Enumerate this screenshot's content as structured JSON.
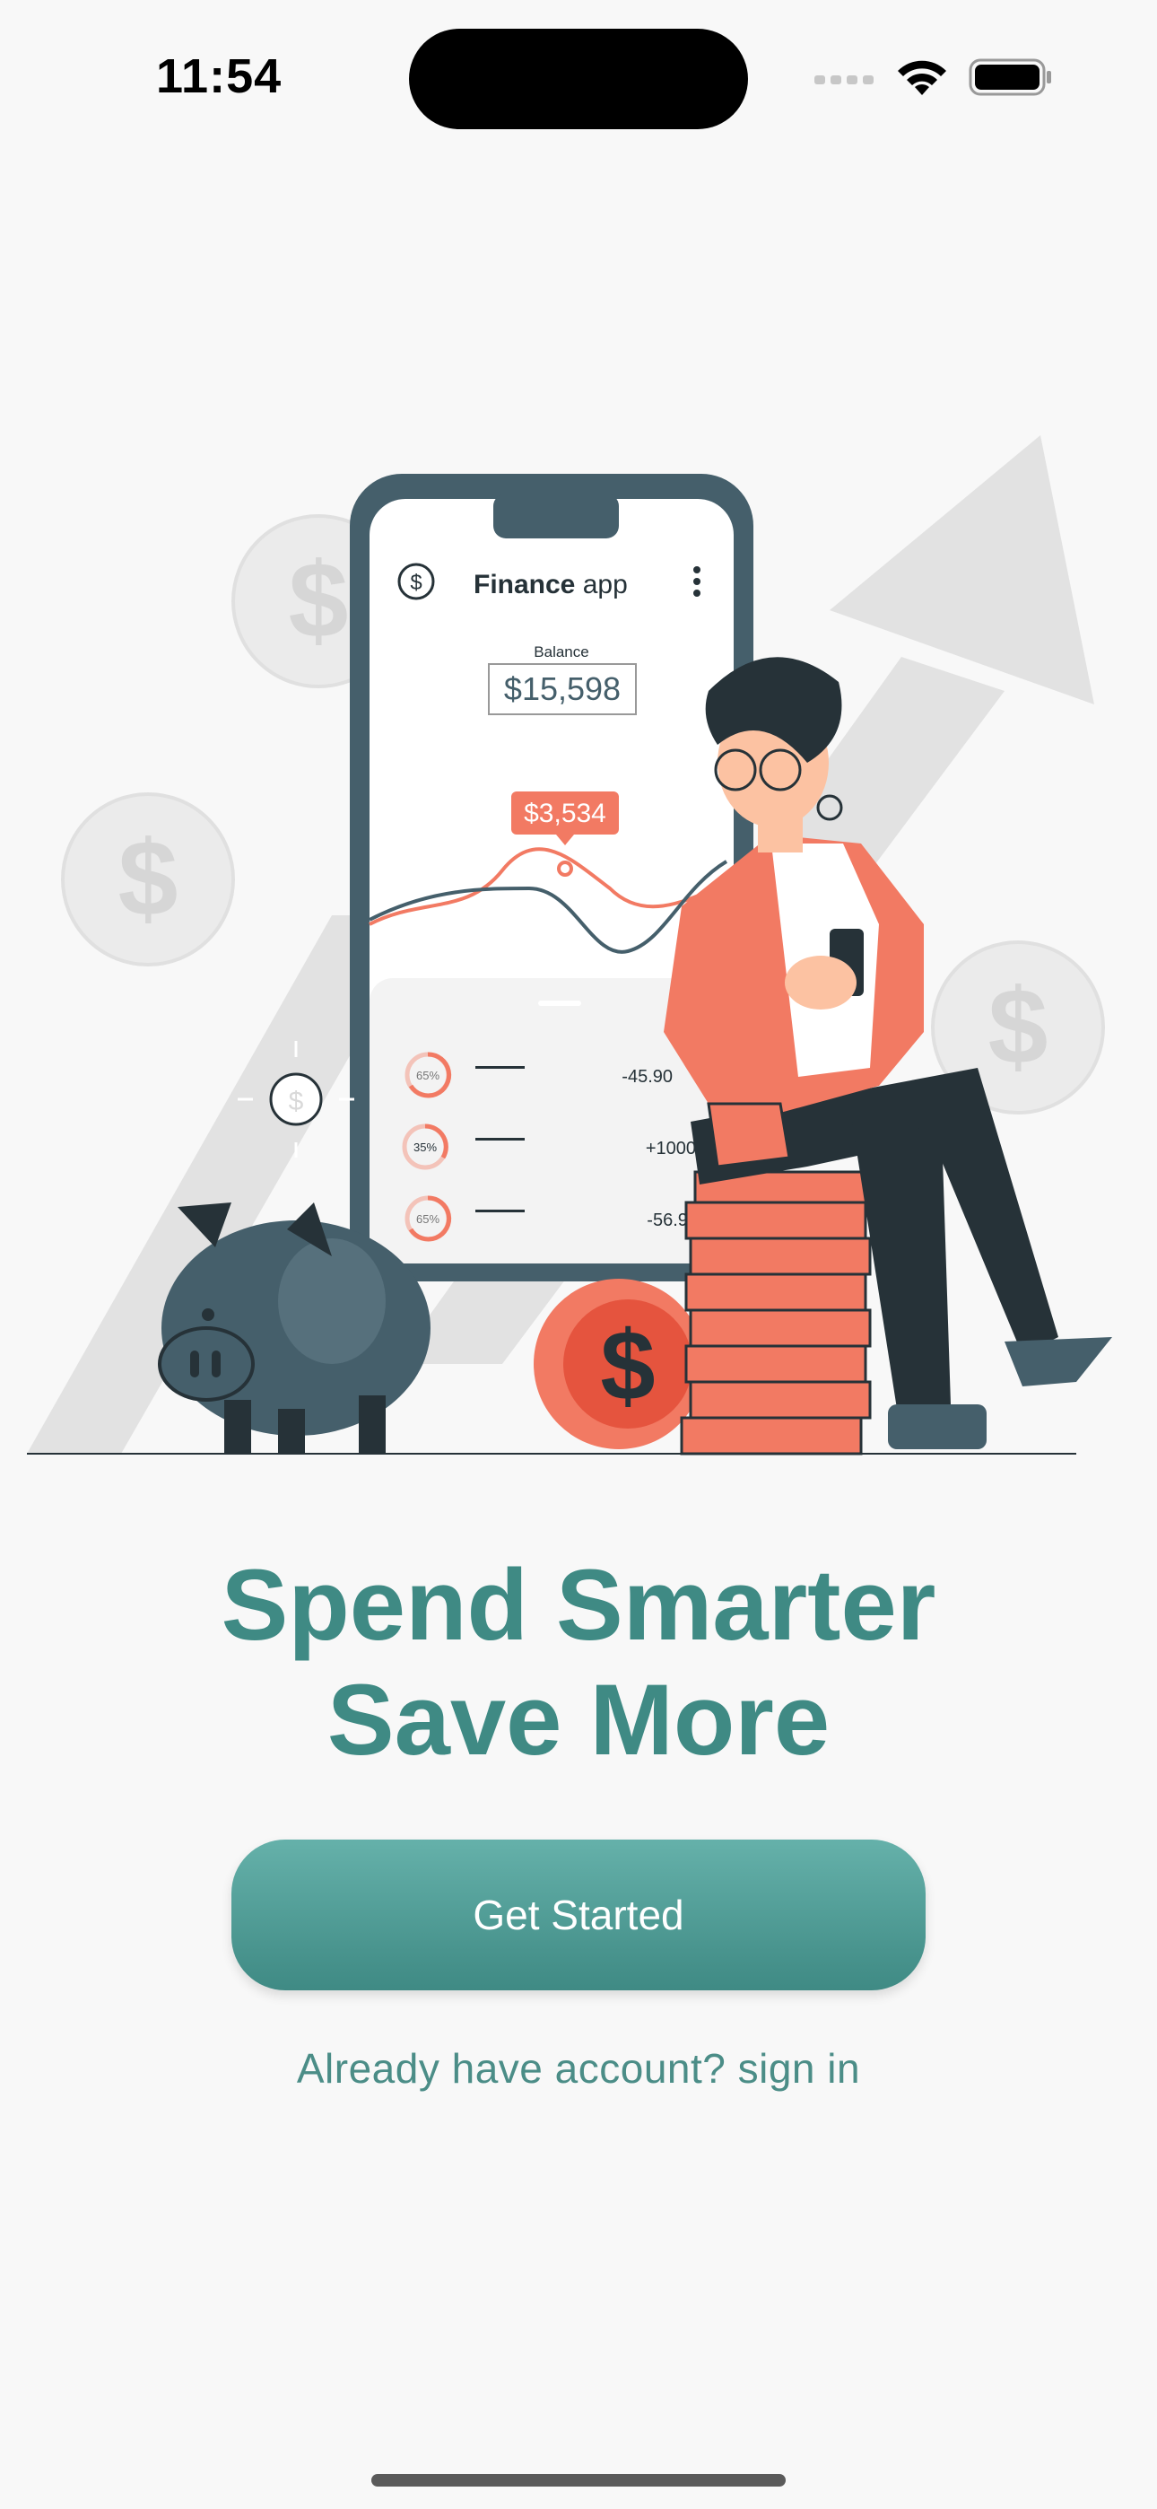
{
  "status_bar": {
    "time": "11:54"
  },
  "illustration": {
    "app_title_bold": "Finance",
    "app_title_rest": " app",
    "balance_label": "Balance",
    "balance_amount": "$15,598",
    "tooltip_amount": "$3,534",
    "transactions": [
      {
        "percent": "65%",
        "amount": "-45.90"
      },
      {
        "percent": "35%",
        "amount": "+1000"
      },
      {
        "percent": "65%",
        "amount": "-56.90"
      }
    ],
    "colors": {
      "accent": "#f27a63",
      "dark": "#455f6b",
      "navy": "#263238"
    }
  },
  "headline": {
    "line1": "Spend Smarter",
    "line2": "Save More"
  },
  "cta": {
    "label": "Get Started",
    "color_top": "#65b1aa",
    "color_bottom": "#3f8a84"
  },
  "signin_link": "Already have account? sign in"
}
